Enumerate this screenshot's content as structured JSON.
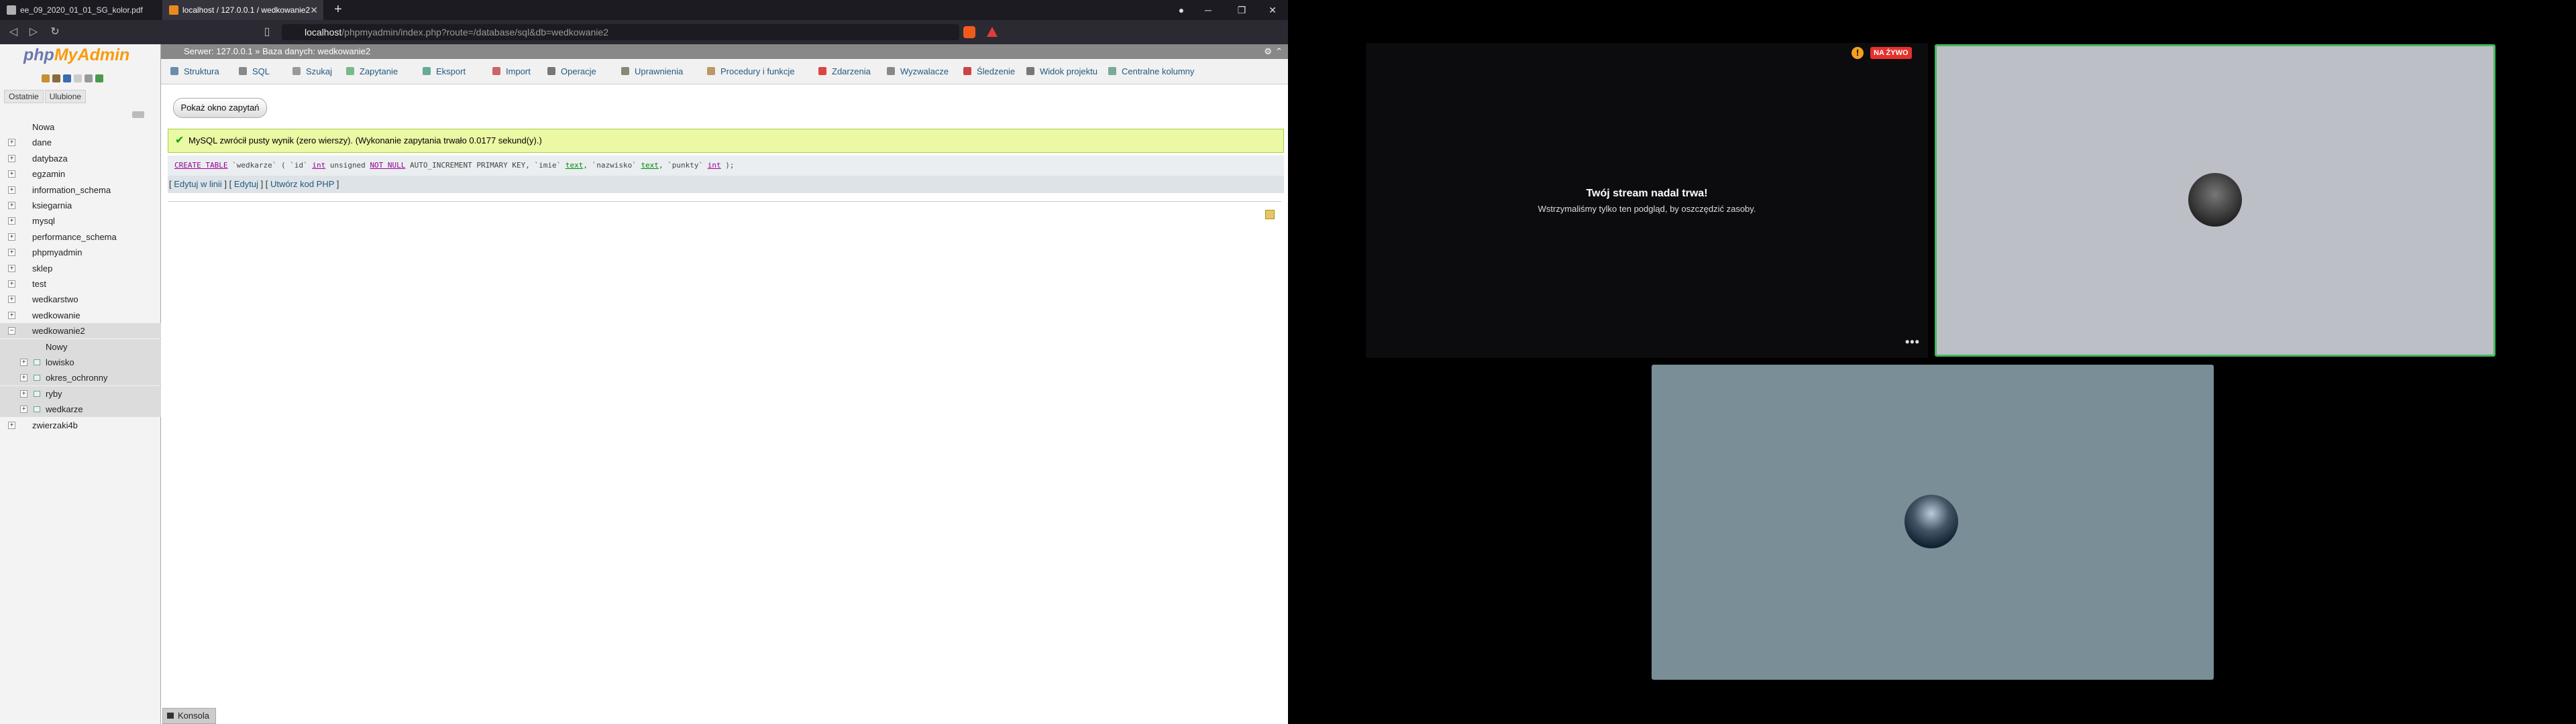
{
  "browser": {
    "tabs": [
      {
        "title": "ee_09_2020_01_01_SG_kolor.pdf"
      },
      {
        "title": "localhost / 127.0.0.1 / wedkowanie2"
      }
    ],
    "new_tab": "+",
    "url": {
      "host": "localhost",
      "path": "/phpmyadmin/index.php?route=/database/sql&db=wedkowanie2"
    }
  },
  "pma": {
    "logo": {
      "part1": "php",
      "part2": "MyAdmin"
    },
    "side_tabs": [
      "Ostatnie",
      "Ulubione"
    ],
    "tree": [
      {
        "label": "Nowa",
        "kind": "new"
      },
      {
        "label": "dane"
      },
      {
        "label": "datybaza"
      },
      {
        "label": "egzamin"
      },
      {
        "label": "information_schema"
      },
      {
        "label": "ksiegarnia"
      },
      {
        "label": "mysql"
      },
      {
        "label": "performance_schema"
      },
      {
        "label": "phpmyadmin"
      },
      {
        "label": "sklep"
      },
      {
        "label": "test"
      },
      {
        "label": "wedkarstwo"
      },
      {
        "label": "wedkowanie"
      },
      {
        "label": "wedkowanie2",
        "selected": true
      },
      {
        "label": "Nowy",
        "kind": "sub-new"
      },
      {
        "label": "lowisko",
        "kind": "table"
      },
      {
        "label": "okres_ochronny",
        "kind": "table"
      },
      {
        "label": "ryby",
        "kind": "table"
      },
      {
        "label": "wedkarze",
        "kind": "table"
      },
      {
        "label": "zwierzaki4b"
      }
    ],
    "breadcrumb": "Serwer: 127.0.0.1 » Baza danych: wedkowanie2",
    "menu": [
      "Struktura",
      "SQL",
      "Szukaj",
      "Zapytanie",
      "Eksport",
      "Import",
      "Operacje",
      "Uprawnienia",
      "Procedury i funkcje",
      "Zdarzenia",
      "Wyzwalacze",
      "Śledzenie",
      "Widok projektu",
      "Centralne kolumny"
    ],
    "show_query_button": "Pokaż okno zapytań",
    "success_message": "MySQL zwrócił pusty wynik (zero wierszy). (Wykonanie zapytania trwało 0.0177 sekund(y).)",
    "sql": {
      "kw_create": "CREATE TABLE",
      "rest1": " `wedkarze` ( `id` ",
      "kw_int": "int",
      "rest2": " unsigned ",
      "kw_notnull": "NOT NULL",
      "rest3": " AUTO_INCREMENT PRIMARY KEY, `imie` ",
      "kw_text1": "text",
      "rest4": ", `nazwisko` ",
      "kw_text2": "text",
      "rest5": ", `punkty` ",
      "kw_int2": "int",
      "rest6": " );"
    },
    "edit_links": [
      "Edytuj w linii",
      "Edytuj",
      "Utwórz kod PHP"
    ],
    "console": "Konsola"
  },
  "stream": {
    "live_badge": "NA ŻYWO",
    "title": "Twój stream nadal trwa!",
    "subtitle": "Wstrzymaliśmy tylko ten podgląd, by oszczędzić zasoby.",
    "more": "•••"
  },
  "colors": {
    "accent_green": "#44b85c",
    "live_red": "#e5312c",
    "pma_link": "#235a81"
  }
}
